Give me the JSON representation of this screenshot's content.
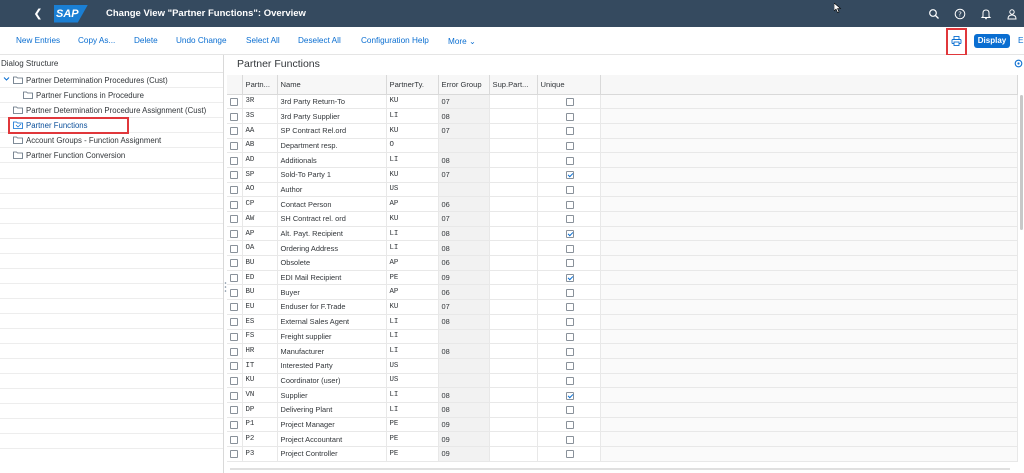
{
  "shell": {
    "logo": "SAP",
    "title": "Change View \"Partner Functions\": Overview",
    "icons": [
      "search-icon",
      "help-icon",
      "notification-icon",
      "user-icon"
    ]
  },
  "toolbar": {
    "new_entries": "New Entries",
    "copy_as": "Copy As...",
    "delete": "Delete",
    "undo_change": "Undo Change",
    "select_all": "Select All",
    "deselect_all": "Deselect All",
    "configuration_help": "Configuration Help",
    "more": "More",
    "display": "Display",
    "overflow": "E"
  },
  "dialog_structure": {
    "title": "Dialog Structure",
    "items": [
      {
        "label": "Partner Determination Procedures (Cust)"
      },
      {
        "label": "Partner Functions in Procedure"
      },
      {
        "label": "Partner Determination Procedure Assignment (Cust)"
      },
      {
        "label": "Partner Functions"
      },
      {
        "label": "Account Groups - Function Assignment"
      },
      {
        "label": "Partner Function Conversion"
      }
    ]
  },
  "table": {
    "heading": "Partner Functions",
    "columns": [
      "Partn...",
      "Name",
      "PartnerTy.",
      "Error Group",
      "Sup.Part...",
      "Unique"
    ],
    "rows": [
      [
        "3R",
        "3rd Party Return-To",
        "KU",
        "07",
        "",
        false
      ],
      [
        "3S",
        "3rd Party Supplier",
        "LI",
        "08",
        "",
        false
      ],
      [
        "AA",
        "SP Contract Rel.ord",
        "KU",
        "07",
        "",
        false
      ],
      [
        "AB",
        "Department resp.",
        "O",
        "",
        "",
        false
      ],
      [
        "AD",
        "Additionals",
        "LI",
        "08",
        "",
        false
      ],
      [
        "SP",
        "Sold-To Party 1",
        "KU",
        "07",
        "",
        true
      ],
      [
        "AO",
        "Author",
        "US",
        "",
        "",
        false
      ],
      [
        "CP",
        "Contact Person",
        "AP",
        "06",
        "",
        false
      ],
      [
        "AW",
        "SH Contract rel. ord",
        "KU",
        "07",
        "",
        false
      ],
      [
        "AP",
        "Alt. Payt. Recipient",
        "LI",
        "08",
        "",
        true
      ],
      [
        "OA",
        "Ordering Address",
        "LI",
        "08",
        "",
        false
      ],
      [
        "BU",
        "Obsolete",
        "AP",
        "06",
        "",
        false
      ],
      [
        "ED",
        "EDI Mail Recipient",
        "PE",
        "09",
        "",
        true
      ],
      [
        "BU",
        "Buyer",
        "AP",
        "06",
        "",
        false
      ],
      [
        "EU",
        "Enduser for F.Trade",
        "KU",
        "07",
        "",
        false
      ],
      [
        "ES",
        "External Sales Agent",
        "LI",
        "08",
        "",
        false
      ],
      [
        "FS",
        "Freight supplier",
        "LI",
        "",
        "",
        false
      ],
      [
        "HR",
        "Manufacturer",
        "LI",
        "08",
        "",
        false
      ],
      [
        "IT",
        "Interested Party",
        "US",
        "",
        "",
        false
      ],
      [
        "KU",
        "Coordinator (user)",
        "US",
        "",
        "",
        false
      ],
      [
        "VN",
        "Supplier",
        "LI",
        "08",
        "",
        true
      ],
      [
        "DP",
        "Delivering Plant",
        "LI",
        "08",
        "",
        false
      ],
      [
        "P1",
        "Project Manager",
        "PE",
        "09",
        "",
        false
      ],
      [
        "P2",
        "Project Accountant",
        "PE",
        "09",
        "",
        false
      ],
      [
        "P3",
        "Project Controller",
        "PE",
        "09",
        "",
        false
      ]
    ]
  },
  "colors": {
    "shell": "#354a5f",
    "accent": "#0a6ed1",
    "highlight": "#e0373b"
  }
}
